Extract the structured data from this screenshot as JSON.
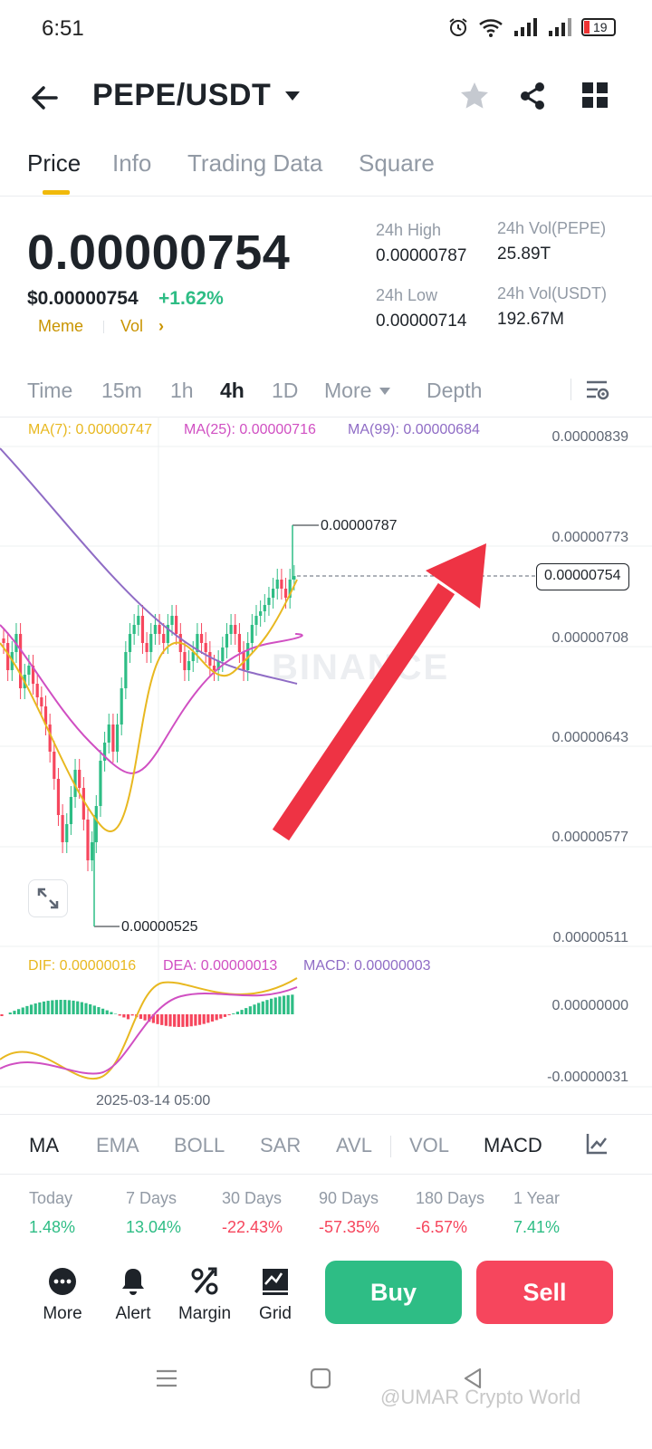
{
  "status": {
    "time": "6:51",
    "battery": "19"
  },
  "header": {
    "pair": "PEPE/USDT"
  },
  "tabs": [
    "Price",
    "Info",
    "Trading Data",
    "Square"
  ],
  "price": {
    "last": "0.00000754",
    "usd": "$0.00000754",
    "change": "+1.62%",
    "tags": [
      "Meme",
      "Vol"
    ],
    "high_label": "24h High",
    "high": "0.00000787",
    "low_label": "24h Low",
    "low": "0.00000714",
    "vol_base_label": "24h Vol(PEPE)",
    "vol_base": "25.89T",
    "vol_quote_label": "24h Vol(USDT)",
    "vol_quote": "192.67M"
  },
  "intervals": [
    "Time",
    "15m",
    "1h",
    "4h",
    "1D",
    "More",
    "Depth"
  ],
  "ma_legend": {
    "ma7": "MA(7): 0.00000747",
    "ma25": "MA(25): 0.00000716",
    "ma99": "MA(99): 0.00000684"
  },
  "chart": {
    "y_ticks": [
      "0.00000839",
      "0.00000773",
      "0.00000708",
      "0.00000643",
      "0.00000577",
      "0.00000511"
    ],
    "high_marker": "0.00000787",
    "low_marker": "0.00000525",
    "current_price": "0.00000754",
    "watermark": "BINANCE"
  },
  "macd_legend": {
    "dif": "DIF: 0.00000016",
    "dea": "DEA: 0.00000013",
    "macd": "MACD: 0.00000003"
  },
  "macd_axis": {
    "top": "0.00000000",
    "bottom": "-0.00000031"
  },
  "time_label": "2025-03-14 05:00",
  "indicators": [
    "MA",
    "EMA",
    "BOLL",
    "SAR",
    "AVL",
    "VOL",
    "MACD"
  ],
  "performance": [
    {
      "label": "Today",
      "value": "1.48%"
    },
    {
      "label": "7 Days",
      "value": "13.04%"
    },
    {
      "label": "30 Days",
      "value": "-22.43%"
    },
    {
      "label": "90 Days",
      "value": "-57.35%"
    },
    {
      "label": "180 Days",
      "value": "-6.57%"
    },
    {
      "label": "1 Year",
      "value": "7.41%"
    }
  ],
  "actions": [
    "More",
    "Alert",
    "Margin",
    "Grid"
  ],
  "buttons": {
    "buy": "Buy",
    "sell": "Sell"
  },
  "footer_watermark": "@UMAR Crypto World",
  "colors": {
    "up": "#2ebd85",
    "down": "#f6465d",
    "accent": "#f0b90b",
    "ma7": "#e8b820",
    "ma25": "#d04fc2",
    "ma99": "#8f6cc5",
    "arrow": "#ee3344"
  }
}
